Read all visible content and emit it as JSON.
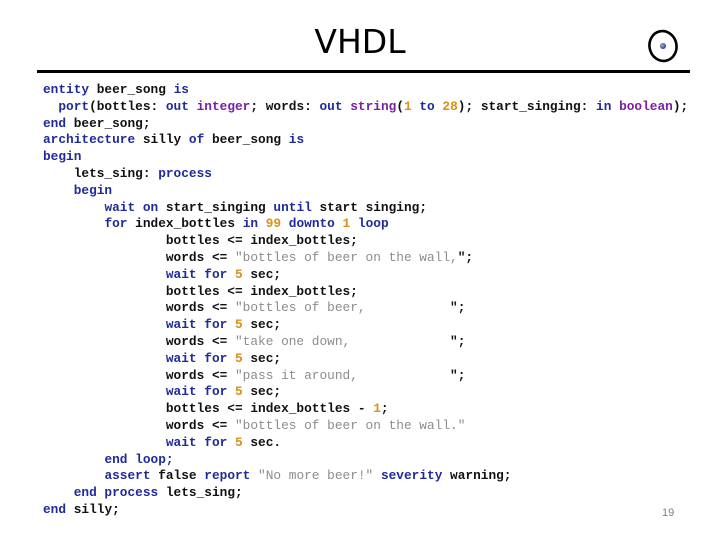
{
  "slide": {
    "title": "VHDL",
    "logo_icon": "circle-dot-logo",
    "page_number": "19"
  },
  "colors": {
    "keyword": "#1f2a9c",
    "type": "#7a1fa2",
    "number": "#d9901a",
    "string": "#8c8c8c",
    "identifier": "#111111"
  },
  "code": {
    "language": "VHDL",
    "lines": [
      {
        "indent": 0,
        "tokens": [
          [
            "kw",
            "entity"
          ],
          [
            "id",
            " beer_song "
          ],
          [
            "kw",
            "is"
          ]
        ]
      },
      {
        "indent": 2,
        "tokens": [
          [
            "kw",
            "port"
          ],
          [
            "id",
            "(bottles: "
          ],
          [
            "kw",
            "out"
          ],
          [
            "id",
            " "
          ],
          [
            "ty",
            "integer"
          ],
          [
            "id",
            "; words: "
          ],
          [
            "kw",
            "out"
          ],
          [
            "id",
            " "
          ],
          [
            "ty",
            "string"
          ],
          [
            "id",
            "("
          ],
          [
            "num",
            "1"
          ],
          [
            "id",
            " "
          ],
          [
            "kw",
            "to"
          ],
          [
            "id",
            " "
          ],
          [
            "num",
            "28"
          ],
          [
            "id",
            "); start_singing: "
          ],
          [
            "kw",
            "in"
          ],
          [
            "id",
            " "
          ],
          [
            "ty",
            "boolean"
          ],
          [
            "id",
            ");"
          ]
        ]
      },
      {
        "indent": 0,
        "tokens": [
          [
            "kw",
            "end"
          ],
          [
            "id",
            " beer_song;"
          ]
        ]
      },
      {
        "indent": 0,
        "tokens": [
          [
            "kw",
            "architecture"
          ],
          [
            "id",
            " silly "
          ],
          [
            "kw",
            "of"
          ],
          [
            "id",
            " beer_song "
          ],
          [
            "kw",
            "is"
          ]
        ]
      },
      {
        "indent": 0,
        "tokens": [
          [
            "kw",
            "begin"
          ]
        ]
      },
      {
        "indent": 4,
        "tokens": [
          [
            "id",
            "lets_sing: "
          ],
          [
            "kw",
            "process"
          ]
        ]
      },
      {
        "indent": 4,
        "tokens": [
          [
            "kw",
            "begin"
          ]
        ]
      },
      {
        "indent": 8,
        "tokens": [
          [
            "kw",
            "wait on"
          ],
          [
            "id",
            " start_singing "
          ],
          [
            "kw",
            "until"
          ],
          [
            "id",
            " start singing;"
          ]
        ]
      },
      {
        "indent": 8,
        "tokens": [
          [
            "kw",
            "for"
          ],
          [
            "id",
            " index_bottles "
          ],
          [
            "kw",
            "in"
          ],
          [
            "id",
            " "
          ],
          [
            "num",
            "99"
          ],
          [
            "id",
            " "
          ],
          [
            "kw",
            "downto"
          ],
          [
            "id",
            " "
          ],
          [
            "num",
            "1"
          ],
          [
            "id",
            " "
          ],
          [
            "kw",
            "loop"
          ]
        ]
      },
      {
        "indent": 16,
        "tokens": [
          [
            "id",
            "bottles <= index_bottles;"
          ]
        ]
      },
      {
        "indent": 16,
        "tokens": [
          [
            "id",
            "words <= "
          ],
          [
            "str",
            "\"bottles of beer on the wall,"
          ],
          [
            "id",
            "\";"
          ]
        ]
      },
      {
        "indent": 16,
        "tokens": [
          [
            "kw",
            "wait for"
          ],
          [
            "id",
            " "
          ],
          [
            "num",
            "5"
          ],
          [
            "id",
            " sec;"
          ]
        ]
      },
      {
        "indent": 16,
        "tokens": [
          [
            "id",
            "bottles <= index_bottles;"
          ]
        ]
      },
      {
        "indent": 16,
        "tokens": [
          [
            "id",
            "words <= "
          ],
          [
            "str",
            "\"bottles of beer,           "
          ],
          [
            "id",
            "\";"
          ]
        ]
      },
      {
        "indent": 16,
        "tokens": [
          [
            "kw",
            "wait for"
          ],
          [
            "id",
            " "
          ],
          [
            "num",
            "5"
          ],
          [
            "id",
            " sec;"
          ]
        ]
      },
      {
        "indent": 16,
        "tokens": [
          [
            "id",
            "words <= "
          ],
          [
            "str",
            "\"take one down,             "
          ],
          [
            "id",
            "\";"
          ]
        ]
      },
      {
        "indent": 16,
        "tokens": [
          [
            "kw",
            "wait for"
          ],
          [
            "id",
            " "
          ],
          [
            "num",
            "5"
          ],
          [
            "id",
            " sec;"
          ]
        ]
      },
      {
        "indent": 16,
        "tokens": [
          [
            "id",
            "words <= "
          ],
          [
            "str",
            "\"pass it around,            "
          ],
          [
            "id",
            "\";"
          ]
        ]
      },
      {
        "indent": 16,
        "tokens": [
          [
            "kw",
            "wait for"
          ],
          [
            "id",
            " "
          ],
          [
            "num",
            "5"
          ],
          [
            "id",
            " sec;"
          ]
        ]
      },
      {
        "indent": 16,
        "tokens": [
          [
            "id",
            "bottles <= index_bottles - "
          ],
          [
            "num",
            "1"
          ],
          [
            "id",
            ";"
          ]
        ]
      },
      {
        "indent": 16,
        "tokens": [
          [
            "id",
            "words <= "
          ],
          [
            "str",
            "\"bottles of beer on the wall.\""
          ]
        ]
      },
      {
        "indent": 16,
        "tokens": [
          [
            "kw",
            "wait for"
          ],
          [
            "id",
            " "
          ],
          [
            "num",
            "5"
          ],
          [
            "id",
            " sec."
          ]
        ]
      },
      {
        "indent": 8,
        "tokens": [
          [
            "kw",
            "end loop;"
          ]
        ]
      },
      {
        "indent": 8,
        "tokens": [
          [
            "kw",
            "assert"
          ],
          [
            "id",
            " false "
          ],
          [
            "kw",
            "report"
          ],
          [
            "id",
            " "
          ],
          [
            "str",
            "\"No more beer!\""
          ],
          [
            "id",
            " "
          ],
          [
            "kw",
            "severity"
          ],
          [
            "id",
            " warning;"
          ]
        ]
      },
      {
        "indent": 4,
        "tokens": [
          [
            "kw",
            "end process"
          ],
          [
            "id",
            " lets_sing;"
          ]
        ]
      },
      {
        "indent": 0,
        "tokens": [
          [
            "kw",
            "end"
          ],
          [
            "id",
            " silly;"
          ]
        ]
      }
    ]
  }
}
